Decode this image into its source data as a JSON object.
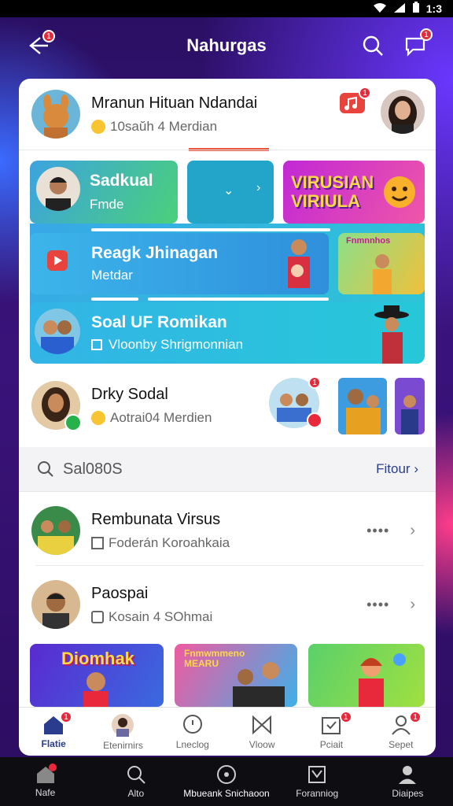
{
  "statusbar": {
    "time": "1:3",
    "icons": [
      "wifi-icon",
      "signal-icon",
      "battery-icon"
    ]
  },
  "header": {
    "title": "Nahurgas",
    "back_badge": "1",
    "chat_badge": "1"
  },
  "top_profile": {
    "name": "Mranun Hituan Ndandai",
    "subtitle": "10saŭh 4 Merdian",
    "notify_badge": "1"
  },
  "feed": {
    "tile1": {
      "title": "Sadkual",
      "sub": "Fmde"
    },
    "banner": {
      "text": "VIRUSIAN VIRIULA"
    },
    "tile3": {
      "title": "Reagk Jhinagan",
      "sub": "Metdar"
    },
    "thumb_text": "Fnmnnhos",
    "tile4": {
      "title": "Soal UF Romikan",
      "sub": "Vloonby Shrigmonnian"
    }
  },
  "profile2": {
    "name": "Drky Sodal",
    "subtitle": "Aotrai04 Merdien",
    "badge": "1"
  },
  "search": {
    "label": "Sal080S",
    "filter": "Fitour"
  },
  "list": [
    {
      "name": "Rembunata Virsus",
      "sub": "Foderán Koroahkaia"
    },
    {
      "name": "Paospai",
      "sub": "Kosain 4 SOhmai"
    }
  ],
  "thumbs": [
    {
      "text": "Diomhak"
    },
    {
      "text": "Fnmwmmeno MEARU"
    },
    {
      "text": ""
    }
  ],
  "bottomnav": [
    {
      "label": "Flatie",
      "icon": "home-icon",
      "badge": "1",
      "active": true
    },
    {
      "label": "Etenirnirs",
      "icon": "avatar-icon",
      "badge": "",
      "active": false
    },
    {
      "label": "Lneclog",
      "icon": "chat-icon",
      "badge": "",
      "active": false
    },
    {
      "label": "Vloow",
      "icon": "bowtie-icon",
      "badge": "",
      "active": false
    },
    {
      "label": "Pciait",
      "icon": "calendar-icon",
      "badge": "1",
      "active": false
    },
    {
      "label": "Sepet",
      "icon": "profile-icon",
      "badge": "1",
      "active": false
    }
  ],
  "sysnav": [
    {
      "label": "Nafe",
      "icon": "home-icon"
    },
    {
      "label": "Alto",
      "icon": "search-icon"
    },
    {
      "label": "Mbueank Snichaoon",
      "icon": "circle-icon"
    },
    {
      "label": "Foranniog",
      "icon": "news-icon"
    },
    {
      "label": "Diaipes",
      "icon": "person-icon"
    }
  ],
  "colors": {
    "accent": "#2a3c8e",
    "badge": "#e8293b",
    "underline": "#e8533c"
  }
}
